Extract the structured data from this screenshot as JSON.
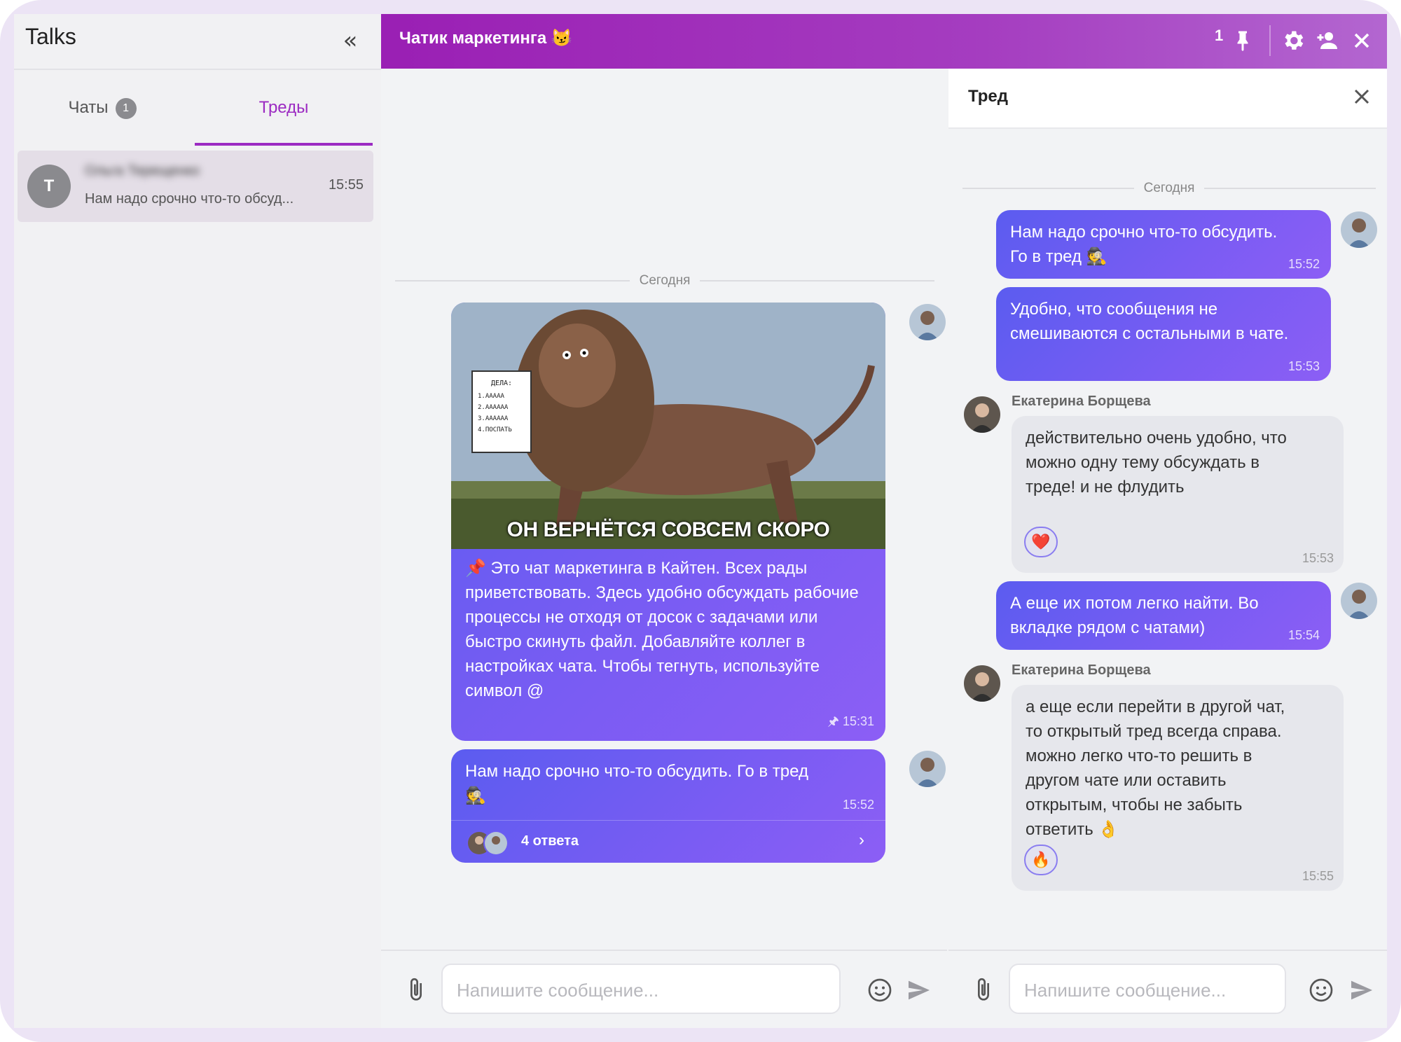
{
  "sidebar": {
    "title": "Talks",
    "tabs": [
      {
        "label": "Чаты",
        "badge": "1"
      },
      {
        "label": "Треды"
      }
    ],
    "thread_item": {
      "avatar_letter": "Т",
      "name": "Ольга Терещенко",
      "preview": "Нам надо срочно что-то обсуд...",
      "time": "15:55"
    }
  },
  "header": {
    "title": "Чатик маркетинга 😼",
    "pinned_count": "1"
  },
  "main": {
    "day_label": "Сегодня",
    "messages": [
      {
        "meme_caption": "ОН ВЕРНЁТСЯ СОВСЕМ СКОРО",
        "text": "📌 Это чат маркетинга в Кайтен. Всех рады приветствовать. Здесь удобно обсуждать рабочие процессы не отходя от досок с задачами или быстро скинуть файл. Добавляйте коллег в настройках чата. Чтобы тегнуть, используйте символ @",
        "time": "🖈 15:31"
      },
      {
        "text": "Нам надо срочно что-то обсудить. Го в тред 🕵",
        "time": "15:52",
        "replies": "4 ответа"
      }
    ],
    "composer_placeholder": "Напишите сообщение..."
  },
  "thread": {
    "title": "Тред",
    "day_label": "Сегодня",
    "messages": [
      {
        "text": "Нам надо срочно что-то обсудить. Го в тред 🕵",
        "time": "15:52"
      },
      {
        "text": "Удобно, что сообщения не смешиваются с остальными в чате.",
        "time": "15:53"
      },
      {
        "sender": "Екатерина Борщева",
        "text": "действительно очень удобно, что можно одну тему обсуждать в треде! и не флудить",
        "reaction": "❤️",
        "time": "15:53"
      },
      {
        "text": "А еще их потом легко найти. Во вкладке рядом с чатами)",
        "time": "15:54"
      },
      {
        "sender": "Екатерина Борщева",
        "text": "а еще если перейти в другой чат, то открытый тред всегда справа. можно легко что-то решить в другом чате или оставить открытым, чтобы не забыть ответить 👌",
        "reaction": "🔥",
        "time": "15:55"
      }
    ],
    "composer_placeholder": "Напишите сообщение..."
  },
  "colors": {
    "accent_purple": "#9c2bc2",
    "bubble_start": "#5b5cf0",
    "bubble_end": "#8c5ef5",
    "header_gradient_start": "#9a1fb4",
    "header_gradient_end": "#b366d0"
  },
  "icons": [
    "collapse-icon",
    "pin-icon",
    "gear-icon",
    "add-user-icon",
    "close-icon",
    "attach-icon",
    "emoji-icon",
    "send-icon",
    "chevron-right-icon"
  ]
}
